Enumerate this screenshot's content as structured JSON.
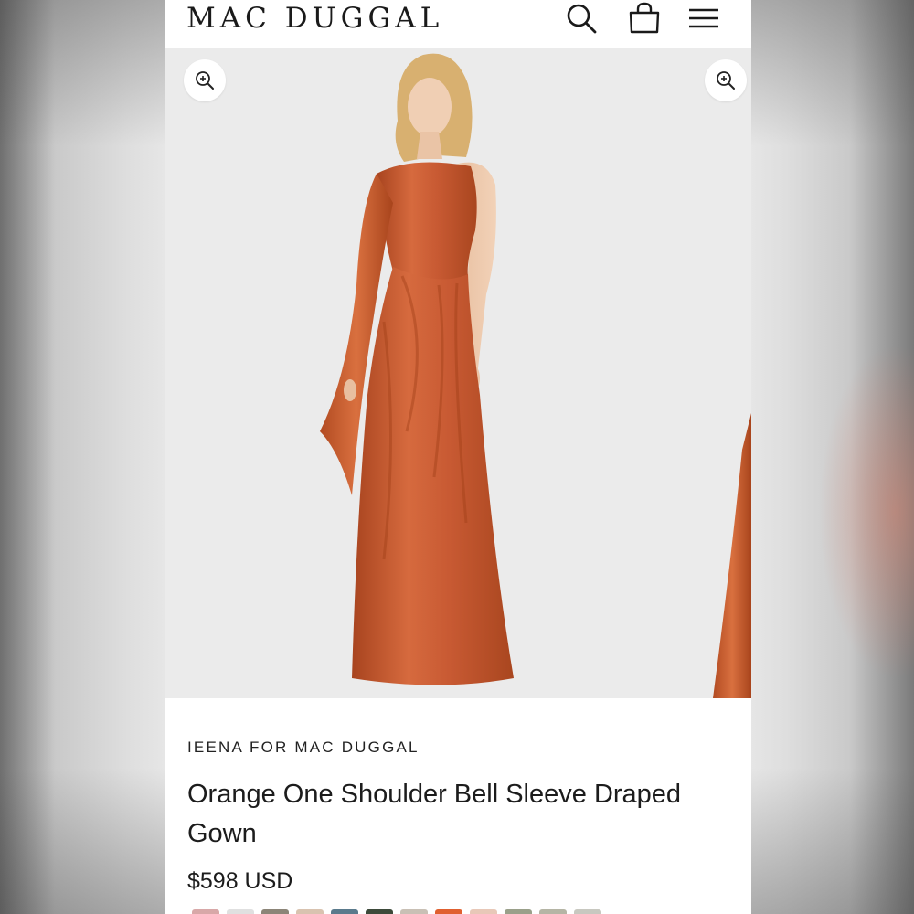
{
  "header": {
    "logo": "MAC DUGGAL",
    "search_icon": "search-icon",
    "bag_icon": "shopping-bag-icon",
    "menu_icon": "hamburger-menu-icon"
  },
  "gallery": {
    "zoom_icon": "zoom-in-icon",
    "image_subject": "model wearing orange one-shoulder draped satin gown",
    "dress_color": "#c85a33"
  },
  "product": {
    "brand": "IEENA FOR MAC DUGGAL",
    "title": "Orange One Shoulder Bell Sleeve Draped Gown",
    "price": "$598 USD"
  },
  "swatch_colors": [
    "#d8a8a8",
    "#e0e0e0",
    "#8c8578",
    "#d9c3b0",
    "#5a7a8c",
    "#3d4a3a",
    "#c9c0b5",
    "#e06030",
    "#e8c8b8",
    "#9aa08a",
    "#b5b5a5",
    "#c8c8c0"
  ]
}
